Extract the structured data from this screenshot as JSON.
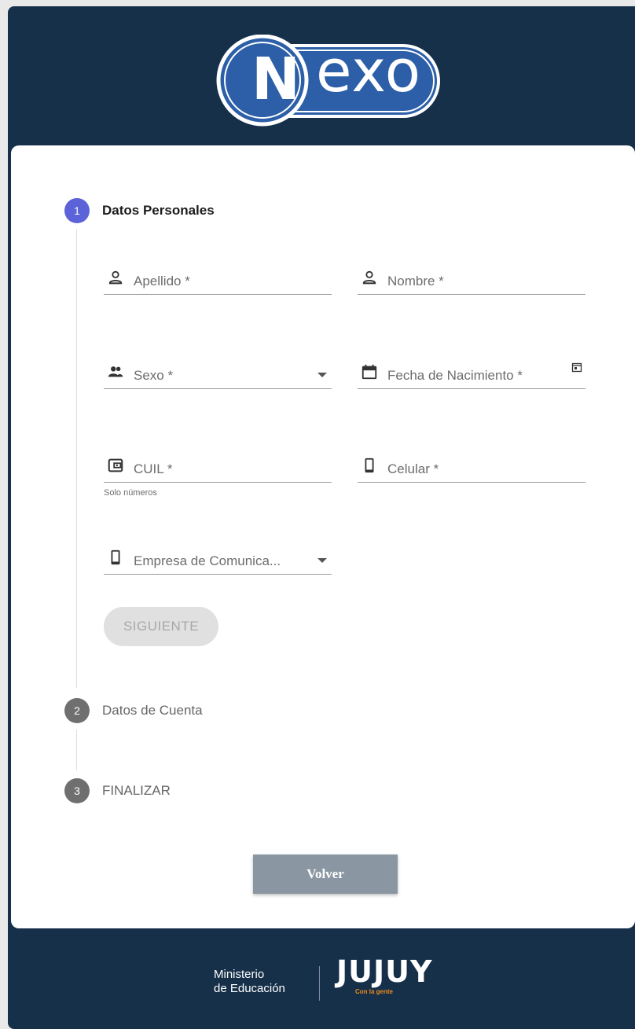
{
  "header": {
    "logo_text": "Nexo",
    "logo_initial": "N",
    "logo_rest": "exo"
  },
  "stepper": {
    "steps": [
      {
        "number": "1",
        "label": "Datos Personales",
        "state": "active"
      },
      {
        "number": "2",
        "label": "Datos de Cuenta",
        "state": "inactive"
      },
      {
        "number": "3",
        "label": "FINALIZAR",
        "state": "inactive"
      }
    ]
  },
  "form": {
    "apellido": {
      "label": "Apellido *",
      "icon": "person-icon"
    },
    "nombre": {
      "label": "Nombre *",
      "icon": "person-icon"
    },
    "sexo": {
      "label": "Sexo *",
      "icon": "people-icon"
    },
    "fecha_nacimiento": {
      "label": "Fecha de Nacimiento *",
      "icon": "calendar-icon"
    },
    "cuil": {
      "label": "CUIL *",
      "icon": "wallet-icon",
      "hint": "Solo números"
    },
    "celular": {
      "label": "Celular *",
      "icon": "phone-icon"
    },
    "empresa": {
      "label": "Empresa de Comunica...",
      "icon": "phone-icon"
    },
    "next_label": "SIGUIENTE"
  },
  "actions": {
    "back_label": "Volver"
  },
  "footer": {
    "ministerio_line1": "Ministerio",
    "ministerio_line2": "de Educación",
    "jujuy": "JUJUY",
    "jujuy_tagline": "Con la gente"
  },
  "colors": {
    "header_bg": "#163049",
    "step_active": "#5c63d8",
    "step_inactive": "#6f6f6f",
    "back_button": "#8a97a2",
    "jujuy_accent": "#f08a1d"
  }
}
